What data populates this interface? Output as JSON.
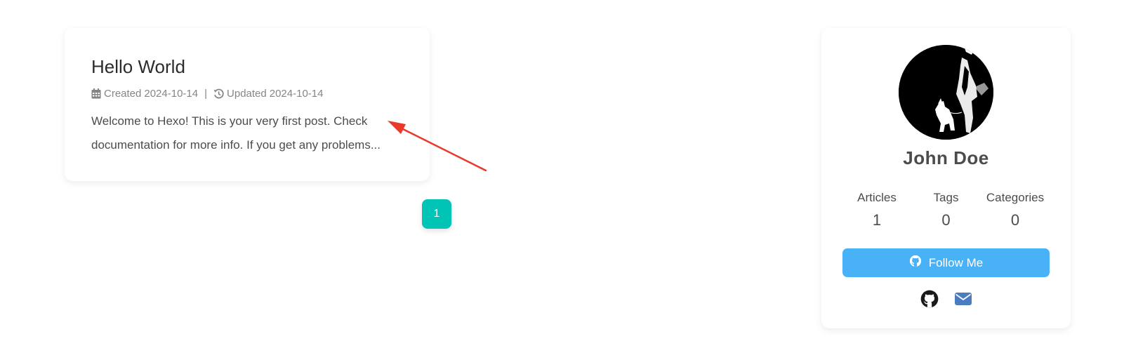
{
  "post": {
    "title": "Hello World",
    "created_label": "Created",
    "created_date": "2024-10-14",
    "separator": "|",
    "updated_label": "Updated",
    "updated_date": "2024-10-14",
    "excerpt": "Welcome to Hexo! This is your very first post. Check documentation for more info. If you get any problems..."
  },
  "pagination": {
    "current_page": "1"
  },
  "profile": {
    "name": "John Doe",
    "stats": [
      {
        "label": "Articles",
        "value": "1"
      },
      {
        "label": "Tags",
        "value": "0"
      },
      {
        "label": "Categories",
        "value": "0"
      }
    ],
    "follow_label": "Follow Me",
    "social_icons": [
      "github-icon",
      "envelope-icon"
    ]
  },
  "colors": {
    "accent_teal": "#00c4b6",
    "follow_blue": "#49b1f5",
    "annotation_red": "#e8392b",
    "mail_blue": "#4a7cc0"
  },
  "icons": {
    "calendar": "calendar-icon",
    "history": "history-icon",
    "github": "github-icon",
    "envelope": "envelope-icon"
  }
}
